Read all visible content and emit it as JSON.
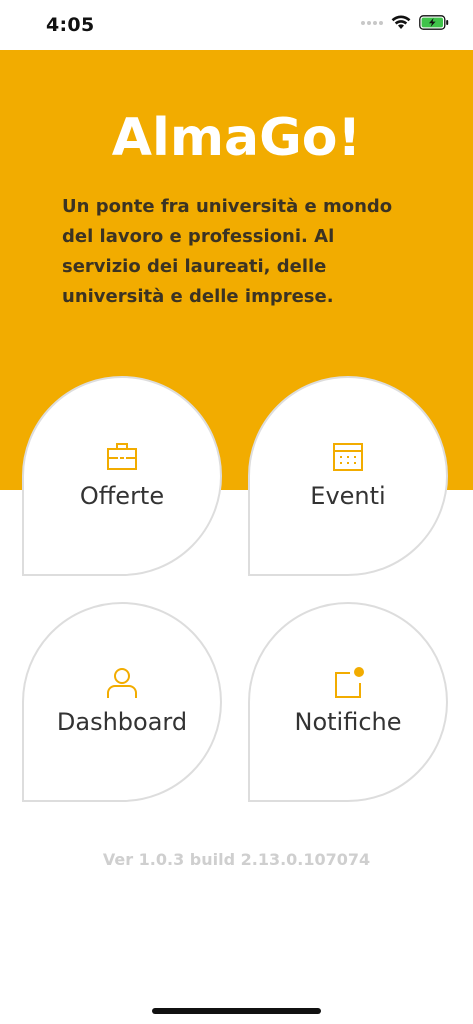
{
  "status": {
    "time": "4:05"
  },
  "hero": {
    "title": "AlmaGo!",
    "tagline": "Un ponte fra università e mondo del lavoro e professioni. Al servizio dei laureati, delle università e delle imprese."
  },
  "tiles": [
    {
      "label": "Offerte",
      "icon": "briefcase-icon"
    },
    {
      "label": "Eventi",
      "icon": "calendar-icon"
    },
    {
      "label": "Dashboard",
      "icon": "user-icon"
    },
    {
      "label": "Notifiche",
      "icon": "notification-icon"
    }
  ],
  "footer": {
    "version": "Ver 1.0.3 build 2.13.0.107074"
  },
  "colors": {
    "brand": "#f2ac00",
    "text_dark": "#3b3323",
    "tile_border": "#dddddd",
    "version_text": "#cfcfcf",
    "battery": "#3fc34a"
  }
}
